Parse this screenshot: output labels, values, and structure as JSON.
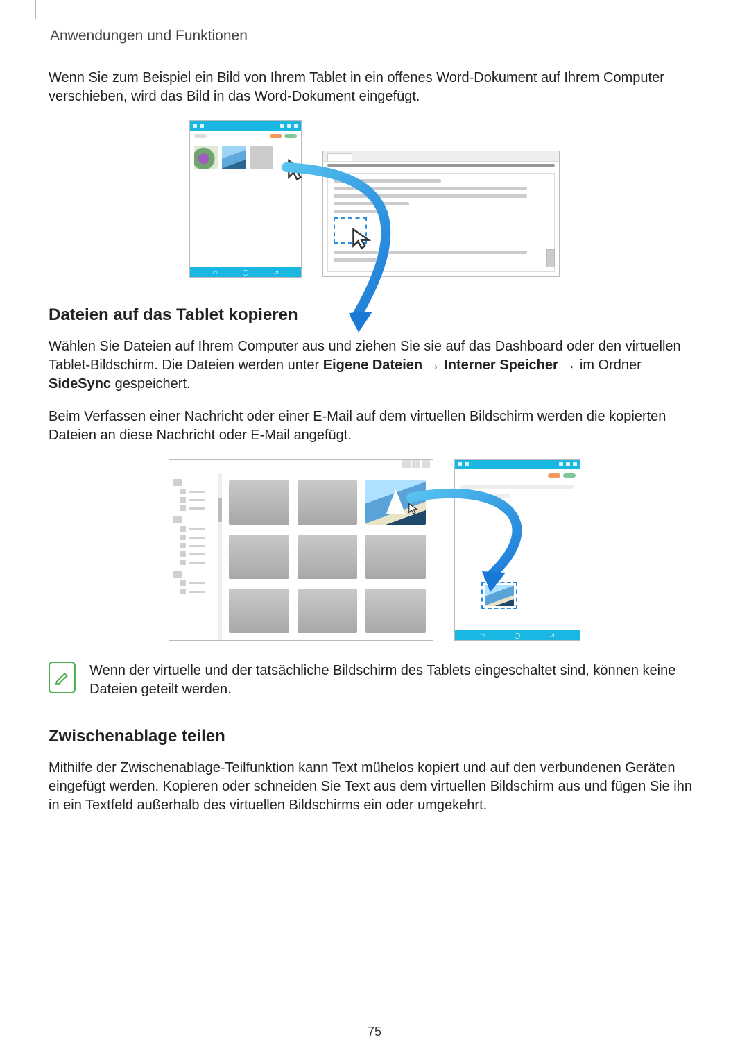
{
  "header": {
    "section_title": "Anwendungen und Funktionen"
  },
  "intro": {
    "paragraph": "Wenn Sie zum Beispiel ein Bild von Ihrem Tablet in ein offenes Word-Dokument auf Ihrem Computer verschieben, wird das Bild in das Word-Dokument eingefügt."
  },
  "section1": {
    "heading": "Dateien auf das Tablet kopieren",
    "p1_pre": "Wählen Sie Dateien auf Ihrem Computer aus und ziehen Sie sie auf das Dashboard oder den virtuellen Tablet-Bildschirm. Die Dateien werden unter ",
    "p1_b1": "Eigene Dateien",
    "p1_arrow1": " → ",
    "p1_b2": "Interner Speicher",
    "p1_arrow2": " → ",
    "p1_mid": "im Ordner ",
    "p1_b3": "SideSync",
    "p1_post": " gespeichert.",
    "p2": "Beim Verfassen einer Nachricht oder einer E-Mail auf dem virtuellen Bildschirm werden die kopierten Dateien an diese Nachricht oder E-Mail angefügt."
  },
  "note": {
    "text": "Wenn der virtuelle und der tatsächliche Bildschirm des Tablets eingeschaltet sind, können keine Dateien geteilt werden."
  },
  "section2": {
    "heading": "Zwischenablage teilen",
    "p1": "Mithilfe der Zwischenablage-Teilfunktion kann Text mühelos kopiert und auf den verbundenen Geräten eingefügt werden. Kopieren oder schneiden Sie Text aus dem virtuellen Bildschirm aus und fügen Sie ihn in ein Textfeld außerhalb des virtuellen Bildschirms ein oder umgekehrt."
  },
  "page_number": "75",
  "icons": {
    "note": "note-pencil-icon",
    "cursor": "cursor-icon",
    "arrow": "drag-arrow"
  }
}
